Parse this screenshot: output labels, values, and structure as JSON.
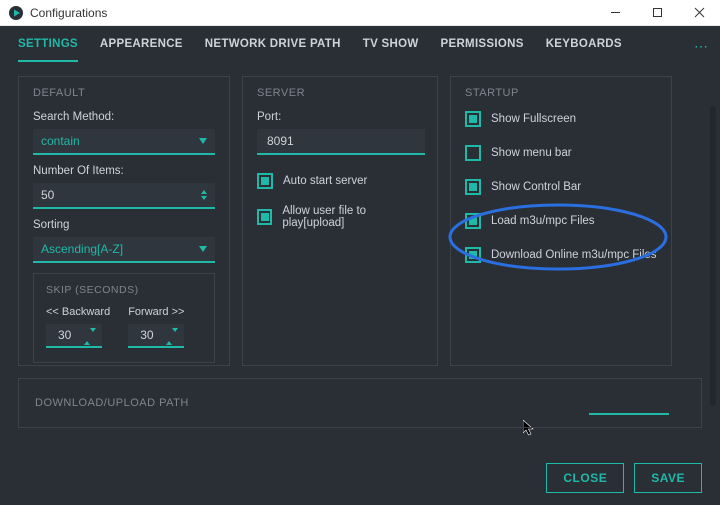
{
  "window": {
    "title": "Configurations"
  },
  "tabs": {
    "settings": "SETTINGS",
    "appearance": "APPEARENCE",
    "network": "NETWORK DRIVE PATH",
    "tvshow": "TV SHOW",
    "permissions": "PERMISSIONS",
    "keyboards": "KEYBOARDS"
  },
  "default": {
    "heading": "DEFAULT",
    "search_method_label": "Search Method:",
    "search_method_value": "contain",
    "num_items_label": "Number Of Items:",
    "num_items_value": "50",
    "sorting_label": "Sorting",
    "sorting_value": "Ascending[A-Z]",
    "skip": {
      "heading": "SKIP (SECONDS)",
      "backward_label": "<< Backward",
      "backward_value": "30",
      "forward_label": "Forward >>",
      "forward_value": "30"
    }
  },
  "server": {
    "heading": "SERVER",
    "port_label": "Port:",
    "port_value": "8091",
    "auto_start": "Auto start server",
    "allow_user_file": "Allow user file to play[upload]"
  },
  "startup": {
    "heading": "STARTUP",
    "fullscreen": "Show Fullscreen",
    "menubar": "Show menu bar",
    "controlbar": "Show Control Bar",
    "load_m3u": "Load m3u/mpc Files",
    "download_m3u": "Download Online m3u/mpc Files"
  },
  "download_path": {
    "heading": "DOWNLOAD/UPLOAD PATH"
  },
  "footer": {
    "close": "CLOSE",
    "save": "SAVE"
  }
}
